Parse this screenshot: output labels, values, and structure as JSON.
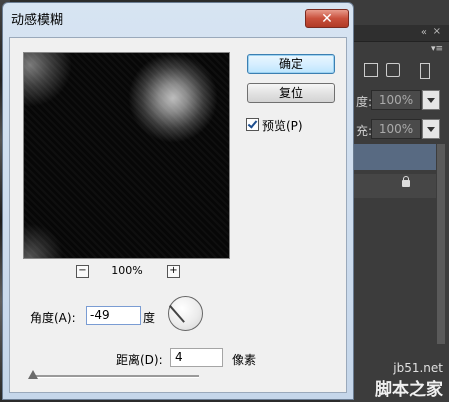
{
  "dialog": {
    "title": "动感模糊",
    "close_icon": "✕",
    "ok_label": "确定",
    "reset_label": "复位",
    "preview_checkbox": {
      "label": "预览(P)",
      "checked": true
    }
  },
  "preview": {
    "zoom_label": "100%",
    "zoom_out_icon": "−",
    "zoom_in_icon": "+"
  },
  "angle": {
    "label": "角度(A):",
    "value": "-49",
    "unit": "度",
    "dial_degrees": -49
  },
  "distance": {
    "label": "距离(D):",
    "value": "4",
    "unit": "像素",
    "slider_fraction": 0.0
  },
  "background_panel": {
    "opacity_label": "度:",
    "opacity_value": "100%",
    "fill_label": "充:",
    "fill_value": "100%",
    "double_arrow_icon": "«",
    "close_icon": "×",
    "menu_icon": "▾≡"
  },
  "watermark": {
    "line1": "jb51.net",
    "line2": "脚本之家"
  },
  "colors": {
    "dialog_bg": "#f0f0f0",
    "title_gradient": "#d7e4f2",
    "close_red": "#c9503c",
    "ok_blue": "#3c7fb1"
  }
}
